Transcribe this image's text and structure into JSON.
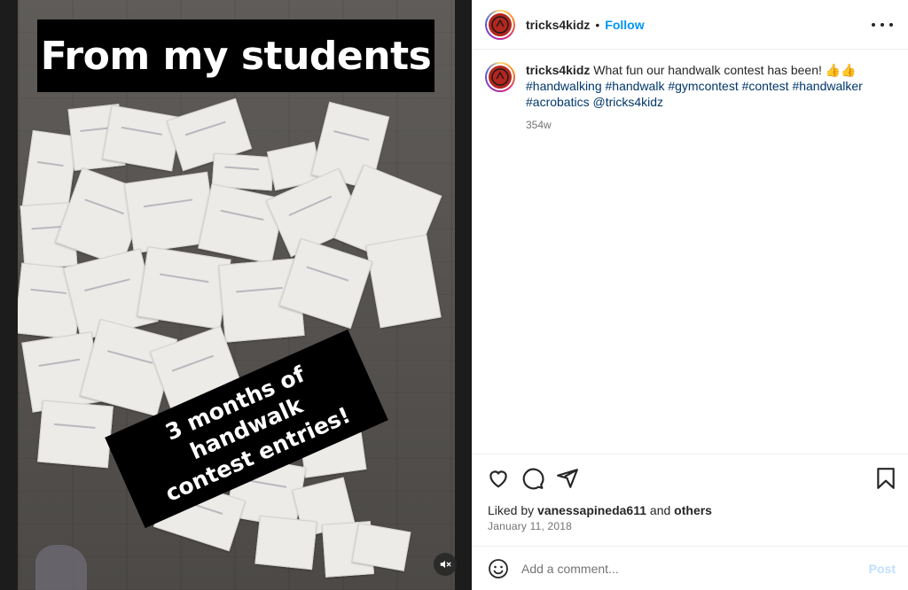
{
  "media": {
    "top_banner": "From my students",
    "tilted_banner_line1": "3 months of handwalk",
    "tilted_banner_line2": "contest entries!"
  },
  "header": {
    "username": "tricks4kidz",
    "separator": "•",
    "follow_label": "Follow"
  },
  "caption": {
    "username": "tricks4kidz",
    "text": "What fun our handwalk contest has been! 👍👍",
    "hashtags": [
      "#handwalking",
      "#handwalk",
      "#gymcontest",
      "#contest",
      "#handwalker",
      "#acrobatics"
    ],
    "mention": "@tricks4kidz",
    "time_ago": "354w"
  },
  "engagement": {
    "liked_by_prefix": "Liked by",
    "liked_by_user": "vanessapineda611",
    "liked_by_and": "and",
    "liked_by_others": "others",
    "date": "January 11, 2018"
  },
  "comment": {
    "placeholder": "Add a comment...",
    "post_label": "Post"
  },
  "icons": {
    "like": "heart-icon",
    "comment": "comment-icon",
    "share": "share-icon",
    "save": "bookmark-icon",
    "emoji": "emoji-icon",
    "more": "more-options-icon",
    "mute": "muted-speaker-icon"
  },
  "colors": {
    "link_blue": "#0095f6",
    "hashtag_blue": "#00376b",
    "post_disabled": "#c0dffd",
    "muted_text": "#737373",
    "banner_black": "#000000"
  }
}
